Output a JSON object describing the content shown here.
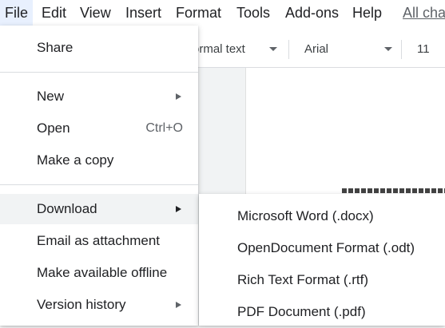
{
  "menubar": {
    "items": [
      "File",
      "Edit",
      "View",
      "Insert",
      "Format",
      "Tools",
      "Add-ons",
      "Help"
    ],
    "all_changes_link": "All cha"
  },
  "toolbar": {
    "style_select": "ormal text",
    "font_select": "Arial",
    "font_size": "11"
  },
  "file_menu": {
    "share": "Share",
    "new": "New",
    "open": "Open",
    "open_shortcut": "Ctrl+O",
    "make_copy": "Make a copy",
    "download": "Download",
    "email_attachment": "Email as attachment",
    "make_offline": "Make available offline",
    "version_history": "Version history"
  },
  "download_submenu": {
    "items": [
      "Microsoft Word (.docx)",
      "OpenDocument Format (.odt)",
      "Rich Text Format (.rtf)",
      "PDF Document (.pdf)"
    ]
  },
  "colors": {
    "menu_highlight": "#f1f3f4",
    "active_menu_bg": "#e8f0fe",
    "text": "#202124",
    "secondary_text": "#5f6368"
  }
}
